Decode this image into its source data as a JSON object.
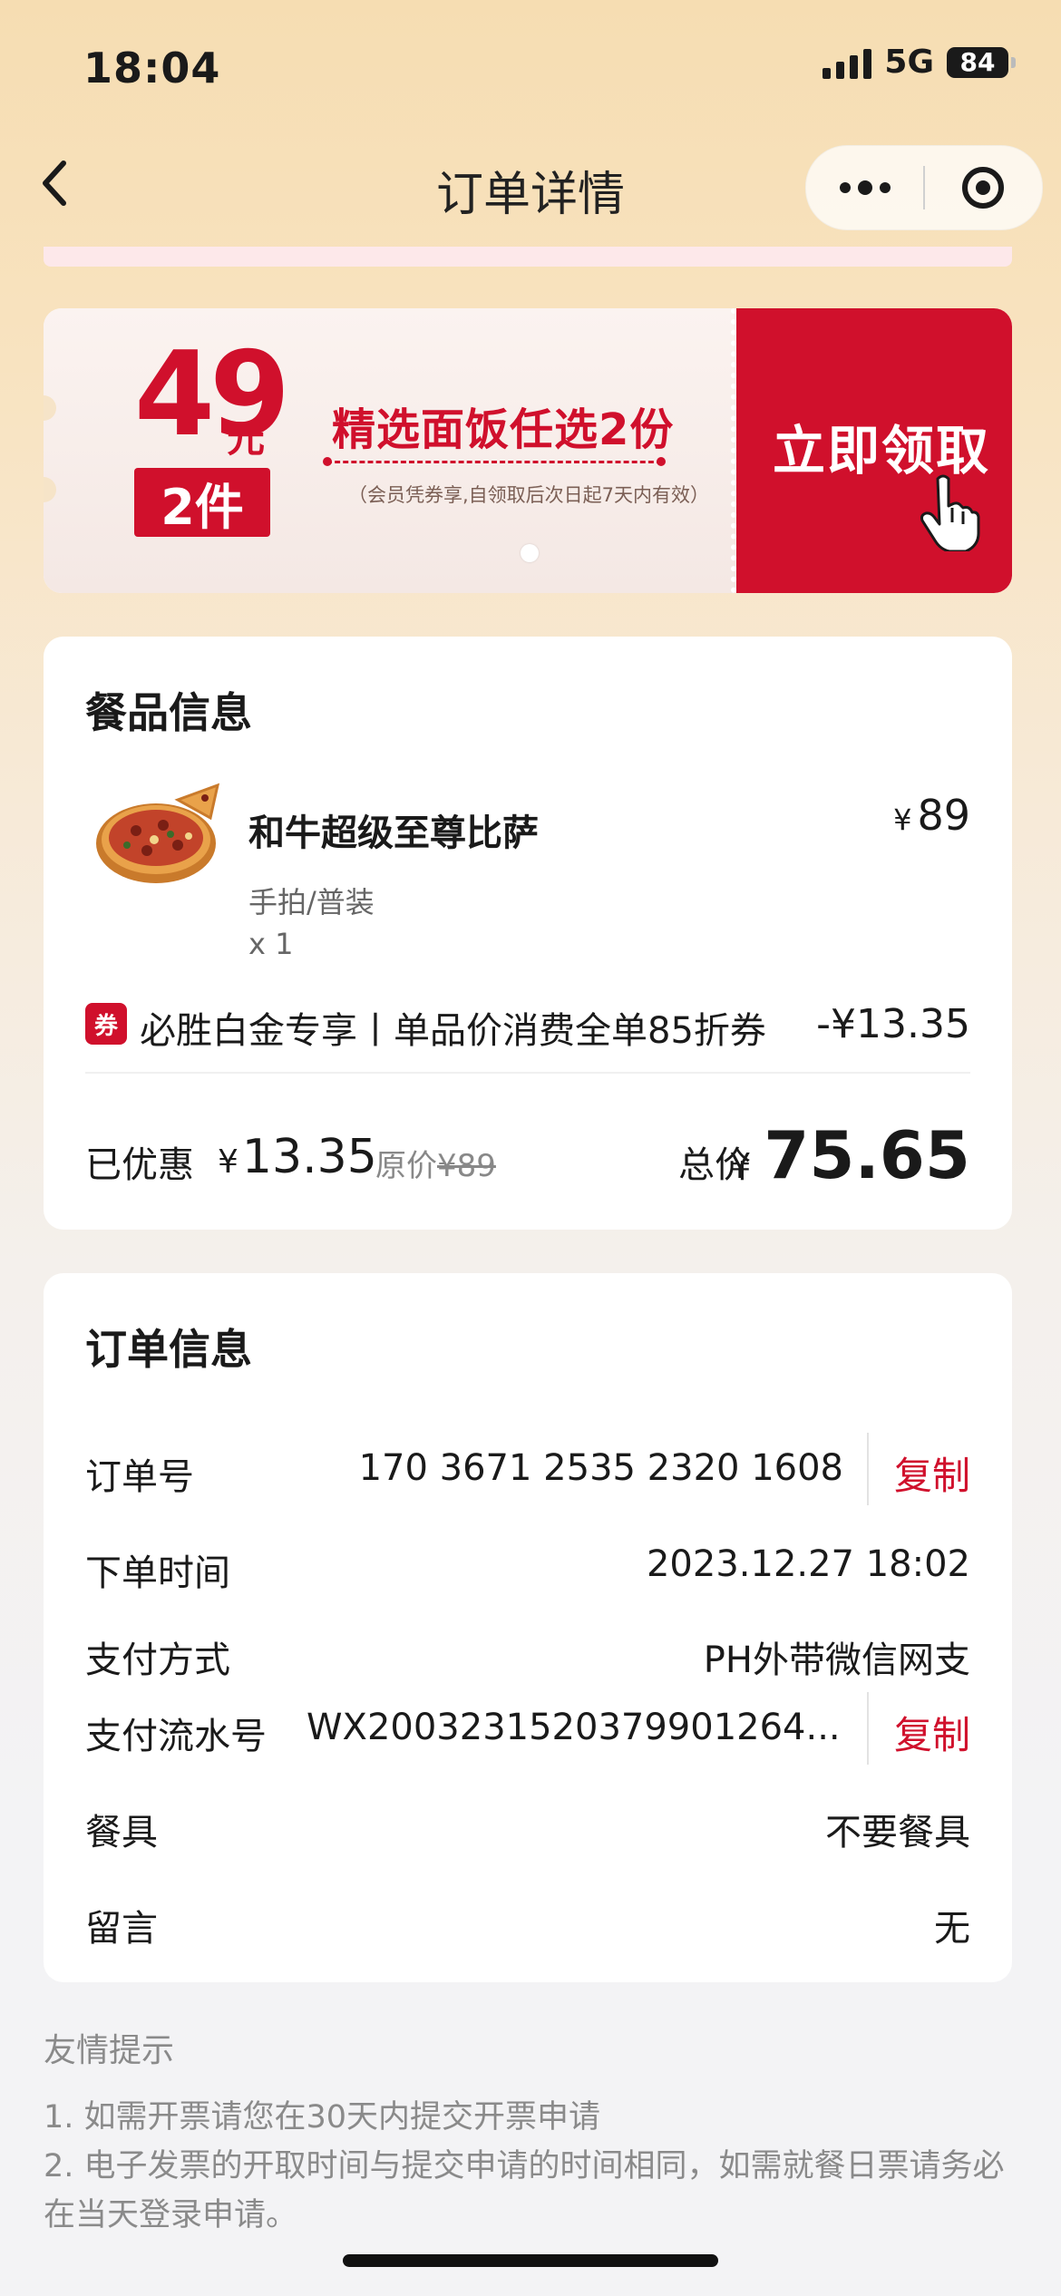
{
  "status_bar": {
    "time": "18:04",
    "network": "5G",
    "battery": "84"
  },
  "nav": {
    "title": "订单详情"
  },
  "banner": {
    "price": "49",
    "unit": "元",
    "quantity": "2件",
    "title": "精选面饭任选2份",
    "note": "（会员凭券享,自领取后次日起7天内有效）",
    "cta": "立即领取"
  },
  "food": {
    "section_title": "餐品信息",
    "item": {
      "name": "和牛超级至尊比萨",
      "currency": "¥",
      "price": "89",
      "spec": "手拍/普装",
      "qty": "x 1"
    },
    "coupon": {
      "badge": "券",
      "text": "必胜白金专享丨单品价消费全单85折券",
      "amount": "-¥13.35"
    },
    "summary": {
      "saved_label": "已优惠",
      "currency": "¥",
      "saved_amount": "13.35",
      "original_label": "原价",
      "original_price": "¥89",
      "total_label": "总价",
      "total_amount": "75.65"
    }
  },
  "order": {
    "section_title": "订单信息",
    "copy_label": "复制",
    "rows": [
      {
        "label": "订单号",
        "value": "170 3671 2535 2320 1608"
      },
      {
        "label": "下单时间",
        "value": "2023.12.27 18:02"
      },
      {
        "label": "支付方式",
        "value": "PH外带微信网支"
      },
      {
        "label": "支付流水号",
        "value": "WX2003231520379901264..."
      },
      {
        "label": "餐具",
        "value": "不要餐具"
      },
      {
        "label": "留言",
        "value": "无"
      }
    ]
  },
  "tips": {
    "title": "友情提示",
    "items": [
      "1. 如需开票请您在30天内提交开票申请",
      "2. 电子发票的开取时间与提交申请的时间相同，如需就餐日票请务必在当天登录申请。"
    ]
  },
  "colors": {
    "accent": "#d0102c",
    "page_top": "#f6ddb2",
    "page_bottom": "#f3f3f5"
  }
}
